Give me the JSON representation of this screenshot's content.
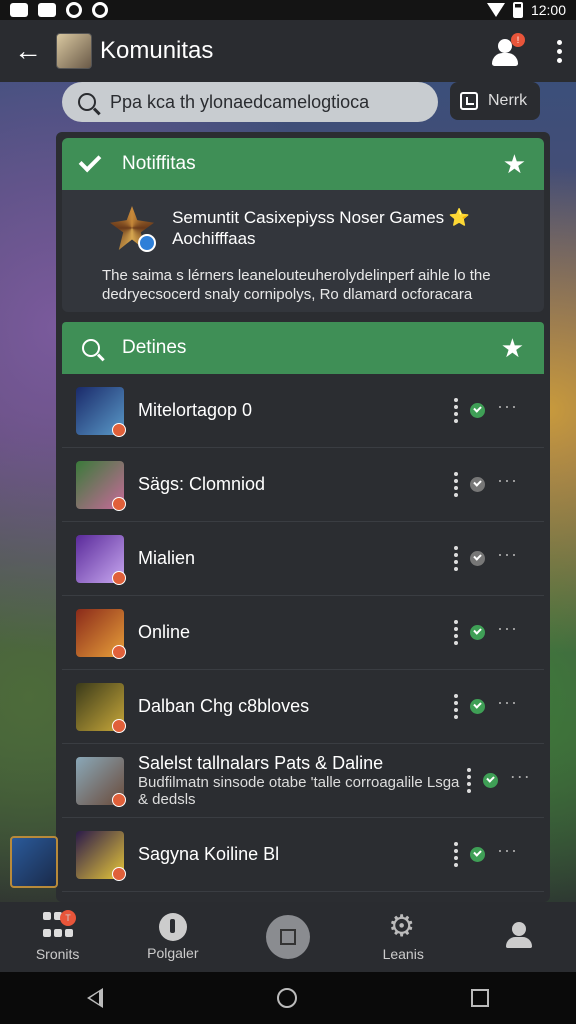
{
  "status": {
    "time": "12:00"
  },
  "appbar": {
    "title": "Komunitas",
    "notif_count": "!"
  },
  "search": {
    "value": "Ppa kca th ylonaedcamelogtioca"
  },
  "nerk": {
    "label": "Nerrk"
  },
  "notification": {
    "header": "Notiffitas",
    "title": "Semuntit Casixepiyss Noser Games ⭐ Aochifffaas",
    "body": "The saima s lérners leanelouteuherolydelinperf aihle lo the dedryecsocerd snaly cornipolys, Ro dlamard ocforacara"
  },
  "details": {
    "header": "Detines",
    "items": [
      {
        "title": "Mitelortagop 0",
        "subtitle": "",
        "status": "green",
        "thumb": [
          "#1a2a6a",
          "#5a9ac8"
        ]
      },
      {
        "title": "Sägs: Clomniod",
        "subtitle": "",
        "status": "gray",
        "thumb": [
          "#3a7a3a",
          "#c86a9a"
        ]
      },
      {
        "title": "Mialien",
        "subtitle": "",
        "status": "gray",
        "thumb": [
          "#5a2a9a",
          "#c8a8f0"
        ]
      },
      {
        "title": "Online",
        "subtitle": "",
        "status": "green",
        "thumb": [
          "#8a2a1a",
          "#e8a03a"
        ]
      },
      {
        "title": "Dalban Chg c8bloves",
        "subtitle": "",
        "status": "green",
        "thumb": [
          "#3a3a1a",
          "#c8a83a"
        ]
      },
      {
        "title": "Salelst tallnalars Pats & Daline",
        "subtitle": "Budfilmatn sinsode otabe 'talle corroagalile Lsga & dedsls",
        "status": "green",
        "thumb": [
          "#8aa8b8",
          "#6a4a3a"
        ]
      },
      {
        "title": "Sagyna Koiline Bl",
        "subtitle": "",
        "status": "green",
        "thumb": [
          "#2a1a4a",
          "#e8c83a"
        ]
      }
    ]
  },
  "bottomnav": {
    "items": [
      {
        "label": "Sronits",
        "badge": "T"
      },
      {
        "label": "Polgaler"
      },
      {
        "label": ""
      },
      {
        "label": "Leanis"
      },
      {
        "label": ""
      }
    ]
  }
}
